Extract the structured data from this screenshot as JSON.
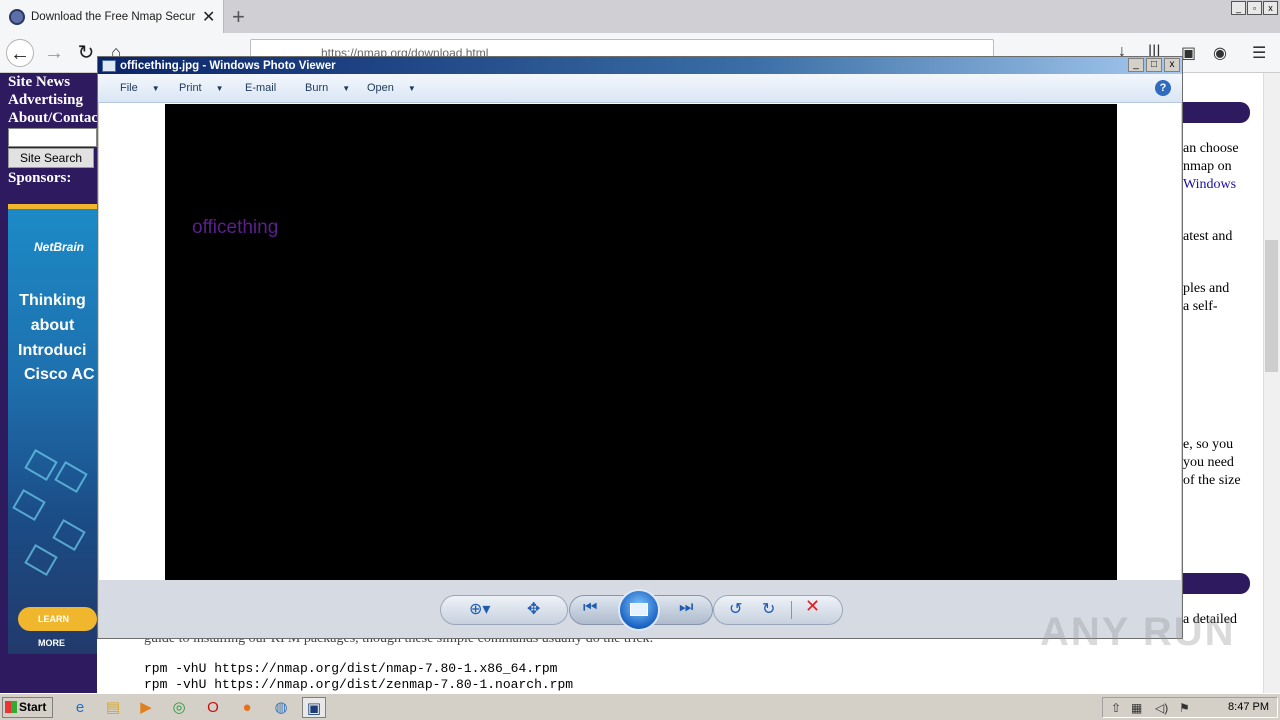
{
  "browser": {
    "tab_title": "Download the Free Nmap Security Scanner",
    "tab_close": "✕",
    "new_tab": "+",
    "url": "https://nmap.org/download.html",
    "back": "←",
    "forward": "→",
    "reload": "↻"
  },
  "site": {
    "nav_links": [
      "Site News",
      "Advertising",
      "About/Contact"
    ],
    "search_button": "Site Search",
    "sponsors": "Sponsors:",
    "ad": {
      "brand": "NetBrain",
      "lines": [
        "Thinking",
        "about",
        "Introduci",
        "Cisco AC"
      ],
      "cta": "LEARN MORE"
    },
    "right_text": [
      "an choose",
      "nmap on",
      "Windows",
      "atest and",
      "ples and",
      "a self-",
      "e, so you",
      "you need",
      "of the size",
      "a detailed"
    ],
    "below_text": "guide to installing our RPM packages, though these simple commands usually do the trick:",
    "rpm_commands": [
      "rpm -vhU https://nmap.org/dist/nmap-7.80-1.x86_64.rpm",
      "rpm -vhU https://nmap.org/dist/zenmap-7.80-1.noarch.rpm"
    ]
  },
  "viewer": {
    "title": "officething.jpg - Windows Photo Viewer",
    "menu": [
      "File",
      "Print",
      "E-mail",
      "Burn",
      "Open"
    ],
    "help": "?",
    "photo_text": "officething",
    "controls": {
      "zoom": "zoom-icon",
      "fit": "actual-size-icon",
      "previous": "previous-icon",
      "slideshow": "slideshow-icon",
      "next": "next-icon",
      "rotate_ccw": "rotate-counterclockwise-icon",
      "rotate_cw": "rotate-clockwise-icon",
      "delete": "delete-icon"
    }
  },
  "taskbar": {
    "start": "Start",
    "clock": "8:47 PM"
  },
  "watermark": "ANY RUN",
  "colors": {
    "site_purple": "#2e1a5e",
    "photo_text": "#5c1f8e",
    "viewer_title_bg": "#0a246a"
  }
}
